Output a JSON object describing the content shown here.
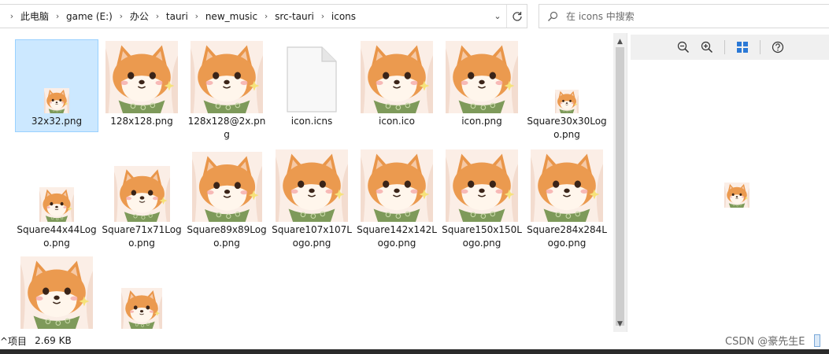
{
  "address": {
    "crumbs": [
      "此电脑",
      "game (E:)",
      "办公",
      "tauri",
      "new_music",
      "src-tauri",
      "icons"
    ],
    "dropdown_icon": "chevron-down-icon",
    "refresh_icon": "refresh-icon"
  },
  "search": {
    "placeholder": "在 icons 中搜索"
  },
  "files": [
    {
      "name": "32x32.png",
      "kind": "shiba",
      "thumb": 32,
      "selected": true
    },
    {
      "name": "128x128.png",
      "kind": "shiba",
      "thumb": 92
    },
    {
      "name": "128x128@2x.png",
      "kind": "shiba",
      "thumb": 92
    },
    {
      "name": "icon.icns",
      "kind": "doc"
    },
    {
      "name": "icon.ico",
      "kind": "shiba",
      "thumb": 92
    },
    {
      "name": "icon.png",
      "kind": "shiba",
      "thumb": 92
    },
    {
      "name": "Square30x30Logo.png",
      "kind": "shiba",
      "thumb": 30
    },
    {
      "name": "Square44x44Logo.png",
      "kind": "shiba",
      "thumb": 44
    },
    {
      "name": "Square71x71Logo.png",
      "kind": "shiba",
      "thumb": 71
    },
    {
      "name": "Square89x89Logo.png",
      "kind": "shiba",
      "thumb": 89
    },
    {
      "name": "Square107x107Logo.png",
      "kind": "shiba",
      "thumb": 92
    },
    {
      "name": "Square142x142Logo.png",
      "kind": "shiba",
      "thumb": 92
    },
    {
      "name": "Square150x150Logo.png",
      "kind": "shiba",
      "thumb": 92
    },
    {
      "name": "Square284x284Logo.png",
      "kind": "shiba",
      "thumb": 92
    },
    {
      "name": "",
      "kind": "shiba",
      "thumb": 92
    },
    {
      "name": "",
      "kind": "shiba",
      "thumb": 52
    }
  ],
  "preview": {
    "toolbar": [
      "zoom-out-icon",
      "zoom-in-icon",
      "view-grid-icon",
      "help-icon"
    ]
  },
  "status": {
    "count": "^项目",
    "size": "2.69 KB",
    "watermark": "CSDN @豪先生E"
  },
  "colors": {
    "selection_bg": "#cce8ff",
    "selection_border": "#99d1ff",
    "accent_blue": "#2b79d6"
  }
}
